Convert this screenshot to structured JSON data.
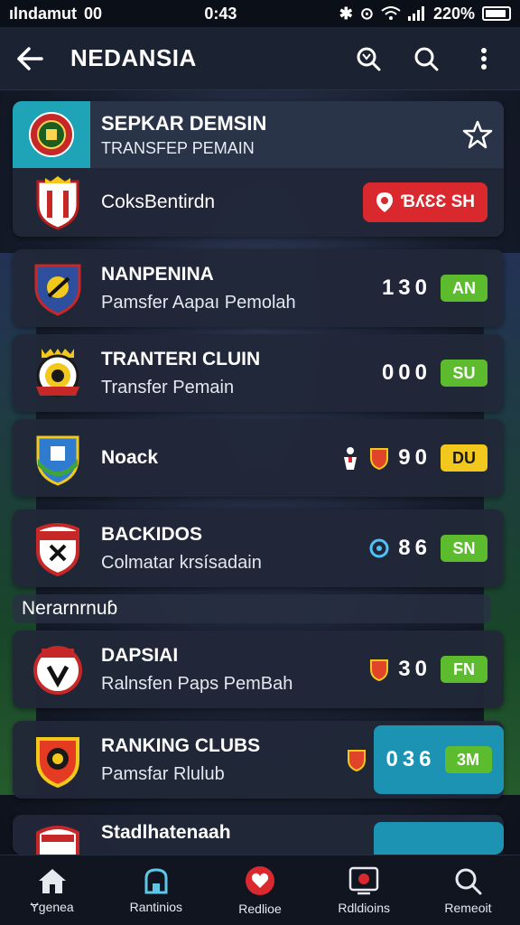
{
  "status_bar": {
    "carrier": "ılndamut",
    "extra": "00",
    "time": "0:43",
    "battery": "220%"
  },
  "app_bar": {
    "title": "NEDANSIA"
  },
  "header": {
    "title": "SEPKAR DEMSIN",
    "subtitle": "TRANSFEP PEMAIN",
    "club_name": "CoksBentirdn",
    "pill_text": "ƁʎƐƐ SH"
  },
  "section_label": "Nerarnrnuɓ",
  "clubs": [
    {
      "name": "NANPENINA",
      "subtitle": "Pamsfer Aapaı Pemolah",
      "score": "130",
      "tag": "AN",
      "tag_color": "green",
      "mini_icons": []
    },
    {
      "name": "TRANTERI CLUIN",
      "subtitle": "Transfer Pemain",
      "score": "000",
      "tag": "SU",
      "tag_color": "green",
      "mini_icons": []
    },
    {
      "name": "Noack",
      "subtitle": "",
      "score": "90",
      "tag": "DU",
      "tag_color": "yellow",
      "mini_icons": [
        "player-icon",
        "shield-icon"
      ]
    },
    {
      "name": "BACKIDOS",
      "subtitle": "Colmatar krsísadain",
      "score": "86",
      "tag": "SN",
      "tag_color": "green",
      "mini_icons": [
        "badge-icon"
      ]
    },
    {
      "name": "DAPSIAI",
      "subtitle": "Ralnsfen Paps PemBah",
      "score": "30",
      "tag": "FN",
      "tag_color": "green",
      "mini_icons": [
        "shield-icon"
      ]
    },
    {
      "name": "RANKING CLUBS",
      "subtitle": "Pamsfar Rlulub",
      "score": "036",
      "tag": "3M",
      "tag_color": "green",
      "mini_icons": [
        "shield-icon"
      ]
    },
    {
      "name": "Stadlhatenaah",
      "subtitle": "",
      "score": "",
      "tag": "",
      "tag_color": "green",
      "mini_icons": []
    }
  ],
  "bottom_nav": [
    {
      "label": "Ɏgenea",
      "icon": "home-icon"
    },
    {
      "label": "Rantinios",
      "icon": "ranking-icon"
    },
    {
      "label": "Redlioe",
      "icon": "live-icon"
    },
    {
      "label": "Rdldioins",
      "icon": "transfer-icon"
    },
    {
      "label": "Remeoit",
      "icon": "search-icon"
    }
  ],
  "colors": {
    "accent_teal": "#1d93b4",
    "green_tag": "#5cbc2e",
    "yellow_tag": "#f2c81c",
    "red_pill": "#d9292e"
  }
}
